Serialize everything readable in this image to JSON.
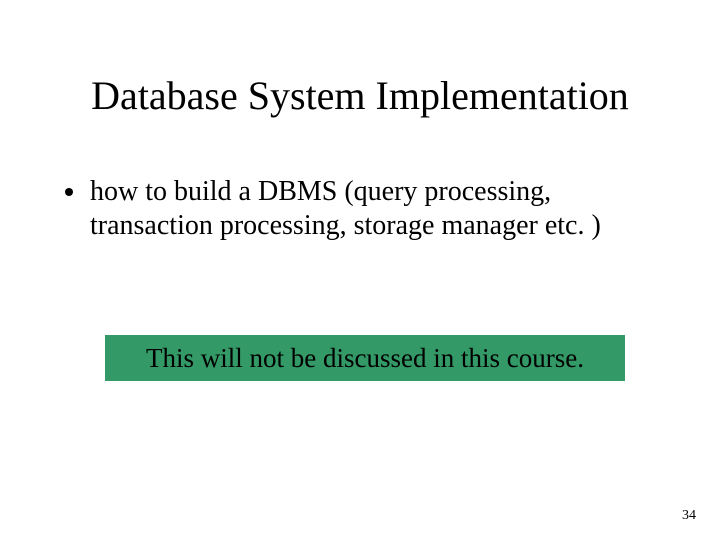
{
  "title": "Database System Implementation",
  "bullets": {
    "item1": "how to build a DBMS (query processing, transaction processing, storage manager etc. )"
  },
  "note": "This will not be discussed in this course.",
  "pageNumber": "34",
  "colors": {
    "noteBackground": "#339966"
  }
}
